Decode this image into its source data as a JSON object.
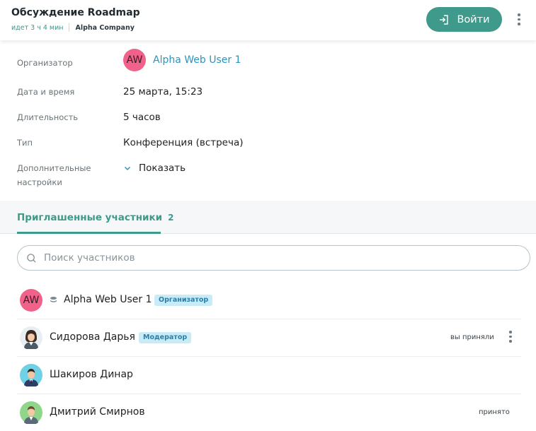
{
  "header": {
    "title": "Обсуждение Roadmap",
    "elapsed": "идет 3 ч 4 мин",
    "company": "Alpha Company",
    "enter_label": "Войти",
    "colors": {
      "accent": "#3f9a8b",
      "link": "#2a94c2"
    }
  },
  "info": {
    "organizer_label": "Организатор",
    "organizer_initials": "AW",
    "organizer_name": "Alpha Web User 1",
    "datetime_label": "Дата и время",
    "datetime_value": "25 марта, 15:23",
    "duration_label": "Длительность",
    "duration_value": "5 часов",
    "type_label": "Тип",
    "type_value": "Конференция (встреча)",
    "extra_label_1": "Дополнительные",
    "extra_label_2": "настройки",
    "show_label": "Показать"
  },
  "tabs": {
    "invited_label": "Приглашенные участники",
    "invited_count": "2"
  },
  "search": {
    "placeholder": "Поиск участников"
  },
  "participants": [
    {
      "initials": "AW",
      "name": "Alpha Web User 1",
      "badge": "Организатор",
      "status": ""
    },
    {
      "name": "Сидорова Дарья",
      "badge": "Модератор",
      "status": "вы приняли"
    },
    {
      "name": "Шакиров Динар",
      "badge": "",
      "status": ""
    },
    {
      "name": "Дмитрий Смирнов",
      "badge": "",
      "status": "принято"
    }
  ]
}
